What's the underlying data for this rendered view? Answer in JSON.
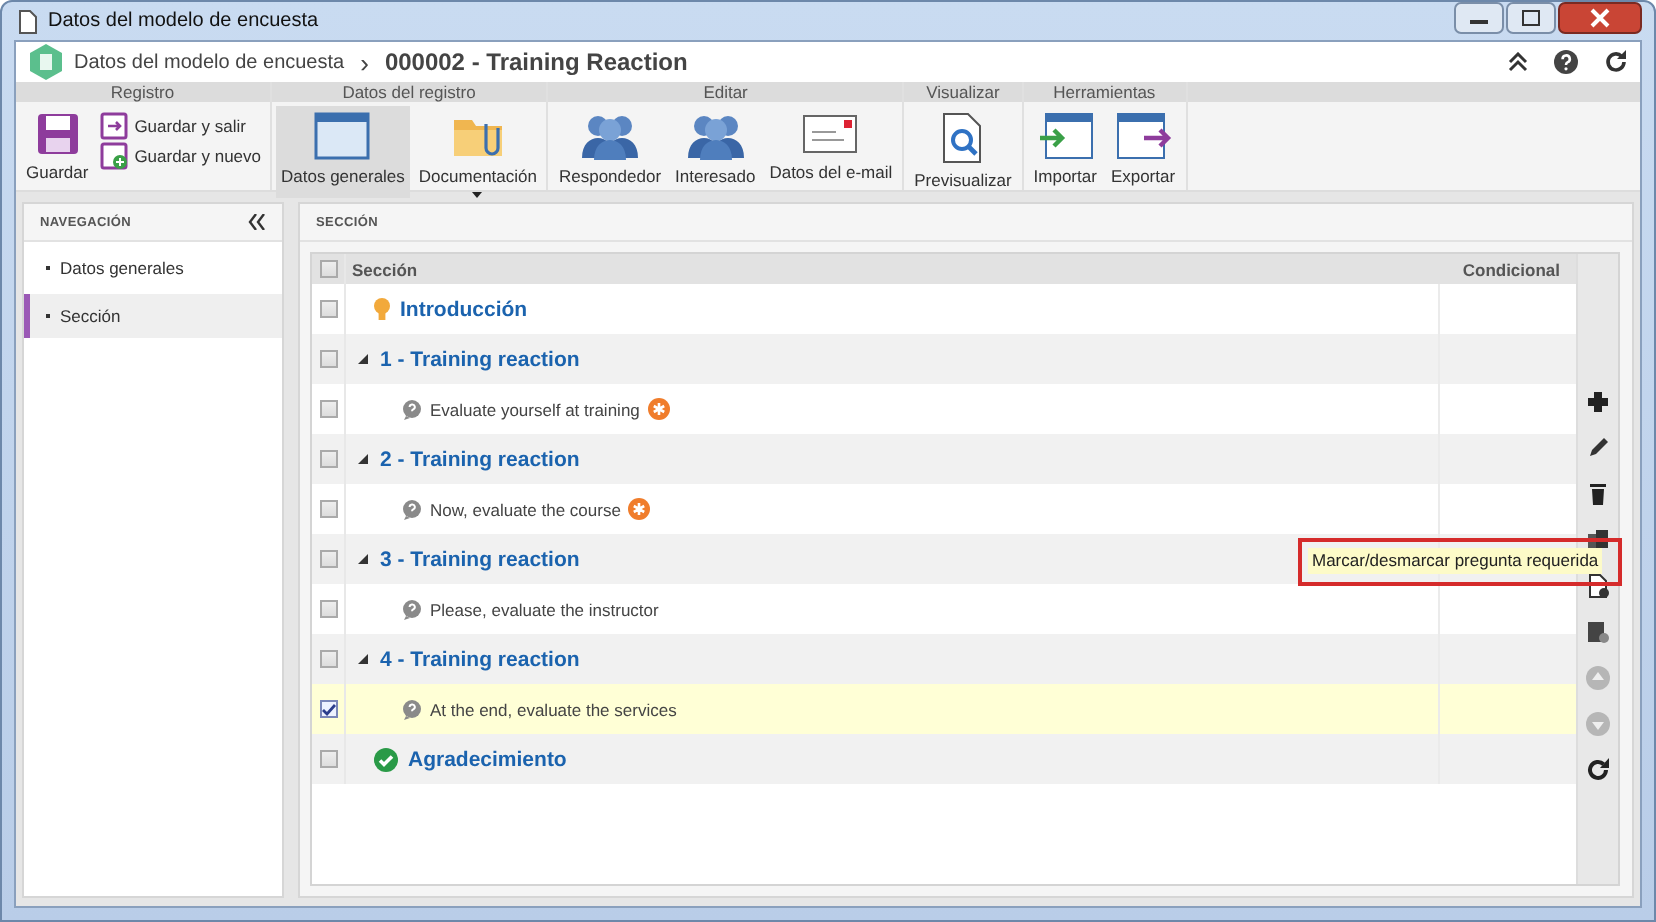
{
  "window": {
    "title": "Datos del modelo de encuesta"
  },
  "header": {
    "breadcrumb": "Datos del modelo de encuesta",
    "separator": "›",
    "title": "000002 - Training Reaction"
  },
  "ribbon": [
    {
      "title": "Registro",
      "buttons": [
        {
          "label": "Guardar",
          "kind": "save",
          "compact": false,
          "selected": false
        },
        {
          "label": "Guardar y salir",
          "kind": "save-exit",
          "compact": true,
          "selected": false
        },
        {
          "label": "Guardar y nuevo",
          "kind": "save-new",
          "compact": true,
          "selected": false
        }
      ]
    },
    {
      "title": "Datos del registro",
      "buttons": [
        {
          "label": "Datos generales",
          "kind": "form",
          "compact": false,
          "selected": true
        },
        {
          "label": "Documentación",
          "kind": "folder",
          "compact": false,
          "selected": false,
          "dropdown": true
        }
      ]
    },
    {
      "title": "Editar",
      "buttons": [
        {
          "label": "Respondedor",
          "kind": "people",
          "compact": false,
          "selected": false
        },
        {
          "label": "Interesado",
          "kind": "people",
          "compact": false,
          "selected": false
        },
        {
          "label": "Datos del e-mail",
          "kind": "email",
          "compact": false,
          "selected": false
        }
      ]
    },
    {
      "title": "Visualizar",
      "buttons": [
        {
          "label": "Previsualizar",
          "kind": "preview",
          "compact": false,
          "selected": false
        }
      ]
    },
    {
      "title": "Herramientas",
      "buttons": [
        {
          "label": "Importar",
          "kind": "import",
          "compact": false,
          "selected": false
        },
        {
          "label": "Exportar",
          "kind": "export",
          "compact": false,
          "selected": false
        }
      ]
    }
  ],
  "sidebar": {
    "title": "NAVEGACIÓN",
    "items": [
      {
        "label": "Datos generales",
        "selected": false
      },
      {
        "label": "Sección",
        "selected": true
      }
    ]
  },
  "main": {
    "title": "SECCIÓN",
    "table": {
      "columns": [
        "Sección",
        "Condicional"
      ],
      "header_checked": false,
      "rows": [
        {
          "kind": "intro",
          "label": "Introducción",
          "checked": false
        },
        {
          "kind": "section",
          "label": "1 - Training reaction",
          "checked": false,
          "expanded": true,
          "children": [
            {
              "label": "Evaluate yourself at training",
              "required": true,
              "checked": false,
              "selected": false
            }
          ]
        },
        {
          "kind": "section",
          "label": "2 - Training reaction",
          "checked": false,
          "expanded": true,
          "children": [
            {
              "label": "Now, evaluate the course",
              "required": true,
              "checked": false,
              "selected": false
            }
          ]
        },
        {
          "kind": "section",
          "label": "3 - Training reaction",
          "checked": false,
          "expanded": true,
          "children": [
            {
              "label": "Please, evaluate the instructor",
              "required": false,
              "checked": false,
              "selected": false
            }
          ]
        },
        {
          "kind": "section",
          "label": "4 - Training reaction",
          "checked": false,
          "expanded": true,
          "children": [
            {
              "label": "At the end, evaluate the services",
              "required": false,
              "checked": true,
              "selected": true
            }
          ]
        },
        {
          "kind": "end",
          "label": "Agradecimiento",
          "checked": false
        }
      ]
    },
    "toolbar": [
      {
        "kind": "add",
        "disabled": false
      },
      {
        "kind": "edit",
        "disabled": false
      },
      {
        "kind": "delete",
        "disabled": false
      },
      {
        "kind": "copy",
        "disabled": false
      },
      {
        "kind": "required",
        "disabled": false
      },
      {
        "kind": "doc-add",
        "disabled": false
      },
      {
        "kind": "up",
        "disabled": true
      },
      {
        "kind": "down",
        "disabled": true
      },
      {
        "kind": "refresh",
        "disabled": false
      }
    ],
    "tooltip": "Marcar/desmarcar pregunta requerida"
  }
}
